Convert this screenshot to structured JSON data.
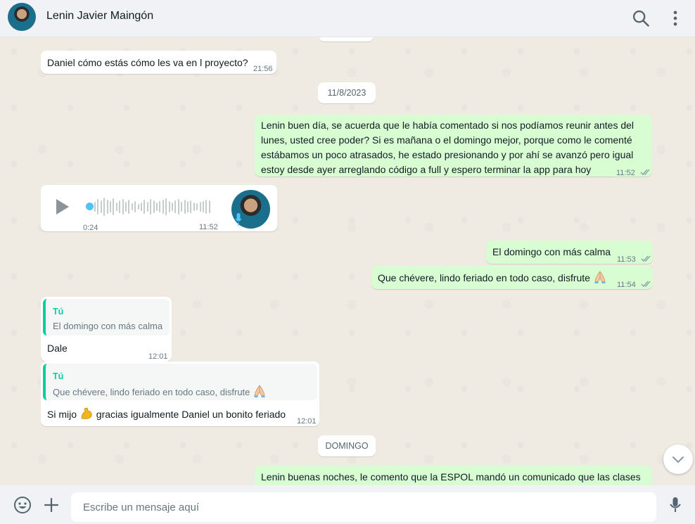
{
  "header": {
    "contact_name": "Lenin Javier Maingón",
    "search_icon": "search-icon",
    "menu_icon": "kebab-menu-icon"
  },
  "chat": {
    "messages": [
      {
        "type": "in",
        "text": "Daniel cómo estás cómo les va en l proyecto?",
        "time": "21:56"
      },
      {
        "type": "date",
        "text": "11/8/2023"
      },
      {
        "type": "out",
        "lines": [
          "Lenin buen día, se acuerda que le había comentado si nos podíamos reunir antes del",
          "lunes, usted cree poder? Si es mañana o el domingo mejor, porque como le comenté",
          "estábamos un poco atrasados, he estado presionando y por ahí se avanzó pero igual",
          "estoy desde ayer arreglando código a full y espero terminar la app para hoy"
        ],
        "time": "11:52",
        "status": "read"
      },
      {
        "type": "voice",
        "duration": "0:24",
        "time": "11:52",
        "icon": "play-icon"
      },
      {
        "type": "out",
        "text": "El domingo con más calma",
        "time": "11:53",
        "status": "read"
      },
      {
        "type": "out",
        "text": "Que chévere, lindo feriado en todo caso, disfrute",
        "emoji": "folded-hands-emoji",
        "time": "11:54",
        "status": "read"
      },
      {
        "type": "in-reply",
        "quote_author": "Tú",
        "quote_text": "El domingo con más calma",
        "text": "Dale",
        "time": "12:01"
      },
      {
        "type": "in-reply",
        "quote_author": "Tú",
        "quote_text": "Que chévere, lindo feriado en todo caso, disfrute",
        "text_before": "Si mijo",
        "text_after": "gracias igualmente Daniel un bonito feriado",
        "emoji": "flexed-biceps-emoji",
        "time": "12:01"
      },
      {
        "type": "date",
        "text": "DOMINGO"
      },
      {
        "type": "out",
        "text": "Lenin buenas noches, le comento que la ESPOL mandó un comunicado que las clases"
      }
    ]
  },
  "footer": {
    "placeholder": "Escribe un mensaje aquí",
    "emoji_icon": "smiley-icon",
    "attach_icon": "plus-icon",
    "mic_icon": "microphone-icon"
  },
  "colors": {
    "outgoing": "#d9fdd3",
    "incoming": "#ffffff",
    "background": "#efeae2",
    "accent": "#06cf9c",
    "read_ticks": "#53bdeb"
  }
}
